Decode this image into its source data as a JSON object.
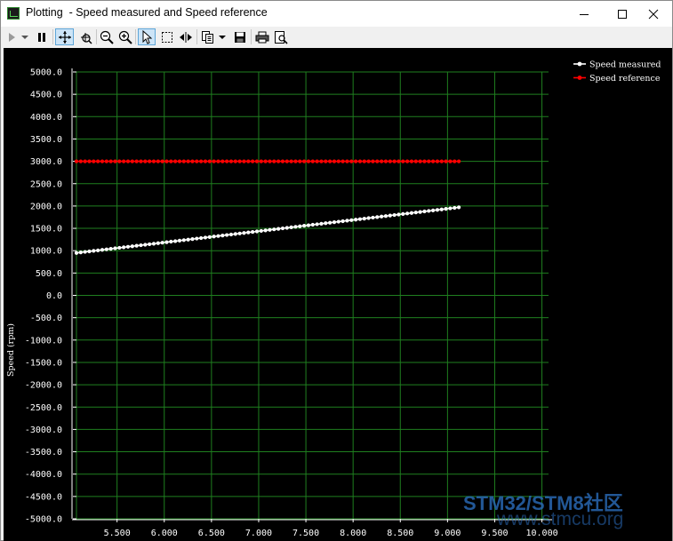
{
  "window": {
    "title": "Plotting  - Speed measured and Speed reference",
    "controls": [
      "minimize",
      "maximize",
      "close"
    ]
  },
  "toolbar": {
    "buttons": [
      {
        "name": "run-icon",
        "state": "disabled"
      },
      {
        "name": "dropdown-icon"
      },
      {
        "name": "pause-icon"
      },
      {
        "name": "pan-icon",
        "state": "active"
      },
      {
        "name": "zoom-region-icon"
      },
      {
        "name": "zoom-out-icon"
      },
      {
        "name": "zoom-in-icon"
      },
      {
        "name": "select-cursor-icon",
        "state": "active"
      },
      {
        "name": "select-rect-icon"
      },
      {
        "name": "fit-horizontal-icon"
      },
      {
        "name": "copy-icon"
      },
      {
        "name": "dropdown-icon"
      },
      {
        "name": "save-icon"
      },
      {
        "name": "print-icon"
      },
      {
        "name": "print-preview-icon"
      }
    ]
  },
  "watermark": {
    "line1": "STM32/STM8社区",
    "line2": "www.stmcu.org"
  },
  "colors": {
    "background": "#000000",
    "grid": "#1f7f1f",
    "measured": "#ffffff",
    "reference": "#ff0000",
    "watermark": "#2a6bb8"
  },
  "chart_data": {
    "type": "line",
    "ylabel": "Speed (rpm)",
    "xlim": [
      5.07,
      10.07
    ],
    "ylim": [
      -5000,
      5000
    ],
    "grid": true,
    "legend_position": "top-right",
    "y_ticks": [
      "5000.0",
      "4500.0",
      "4000.0",
      "3500.0",
      "3000.0",
      "2500.0",
      "2000.0",
      "1500.0",
      "1000.0",
      "500.0",
      "0.0",
      "-500.0",
      "-1000.0",
      "-1500.0",
      "-2000.0",
      "-2500.0",
      "-3000.0",
      "-3500.0",
      "-4000.0",
      "-4500.0",
      "-5000.0"
    ],
    "x_ticks": [
      "5.500",
      "6.000",
      "6.500",
      "7.000",
      "7.500",
      "8.000",
      "8.500",
      "9.000",
      "9.500",
      "10.000"
    ],
    "series": [
      {
        "name": "Speed measured",
        "color": "#ffffff",
        "x_start": 5.07,
        "x_end": 9.12,
        "y_start": 950,
        "y_end": 1970,
        "points": 90
      },
      {
        "name": "Speed reference",
        "color": "#ff0000",
        "x_start": 5.07,
        "x_end": 9.12,
        "y_start": 3000,
        "y_end": 3000,
        "points": 90
      }
    ]
  }
}
